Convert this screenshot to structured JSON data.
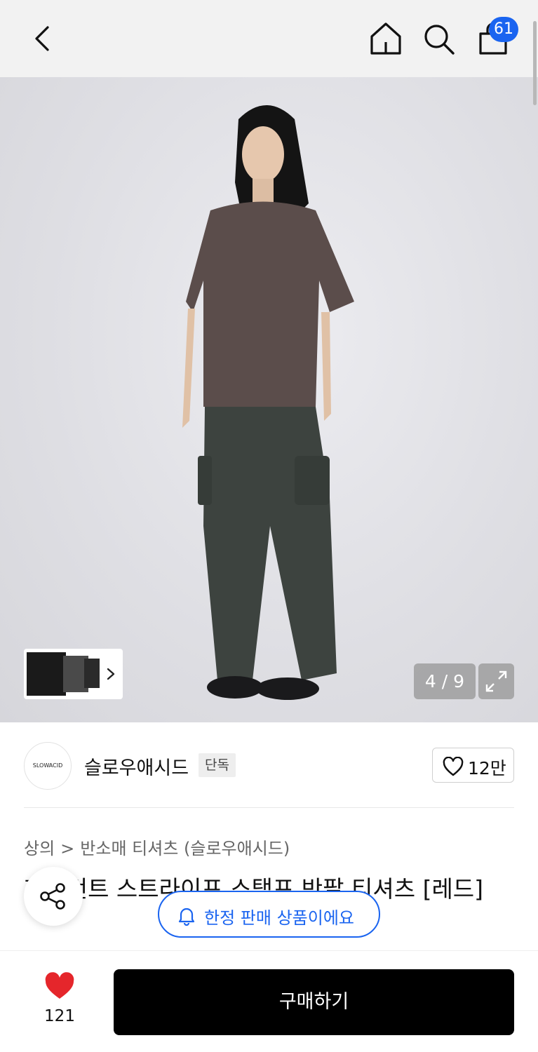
{
  "header": {
    "cart_count": "61"
  },
  "gallery": {
    "counter": "4 / 9"
  },
  "brand": {
    "logo_text": "SLOWACID",
    "name": "슬로우애시드",
    "tag": "단독",
    "like_count": "12만"
  },
  "breadcrumb": {
    "items": [
      "상의",
      "반소매 티셔츠 (슬로우애시드)"
    ],
    "separator": ">"
  },
  "product": {
    "title": "피그먼트 스트라이프 스탬프 반팔 티셔츠 [레드]"
  },
  "limited_badge": "한정 판매 상품이에요",
  "footer": {
    "wish_count": "121",
    "buy_label": "구매하기"
  },
  "colors": {
    "accent_blue": "#1a64f0",
    "heart_red": "#e5262b",
    "buy_button": "#000000"
  },
  "icons": [
    "back-icon",
    "home-icon",
    "search-icon",
    "bag-icon",
    "chevron-right-icon",
    "expand-icon",
    "heart-outline-icon",
    "share-icon",
    "bell-icon",
    "heart-filled-icon"
  ]
}
